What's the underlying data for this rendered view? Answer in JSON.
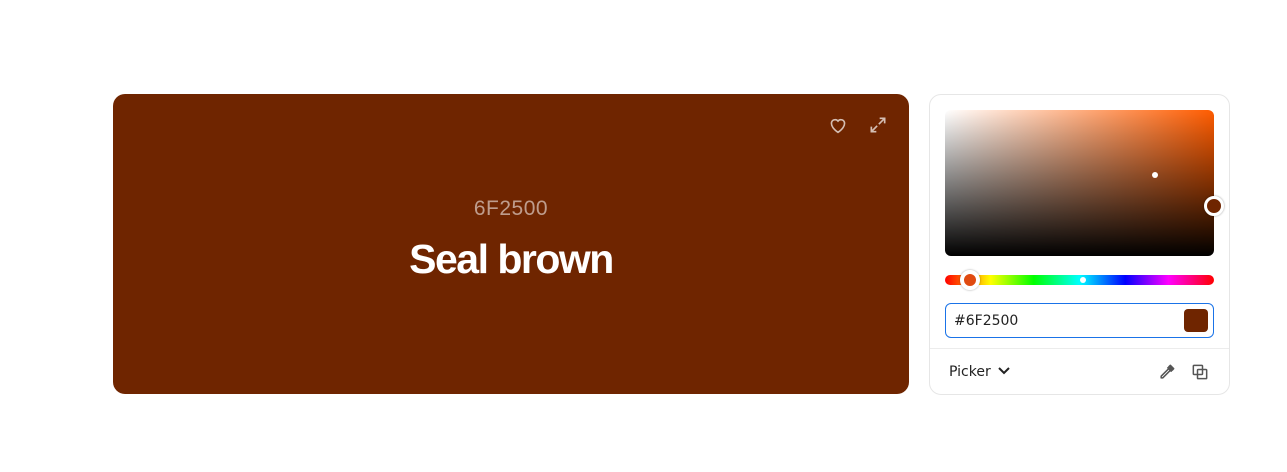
{
  "swatch": {
    "hex_label": "6F2500",
    "color_name": "Seal brown",
    "background": "#6F2500",
    "icons": [
      "heart-icon",
      "expand-icon"
    ]
  },
  "picker": {
    "hue_color": "#FF5C00",
    "hex_value": "#6F2500",
    "preview_color": "#6F2500",
    "mode_label": "Picker",
    "tools": [
      "eyedropper-icon",
      "copy-icon"
    ]
  }
}
